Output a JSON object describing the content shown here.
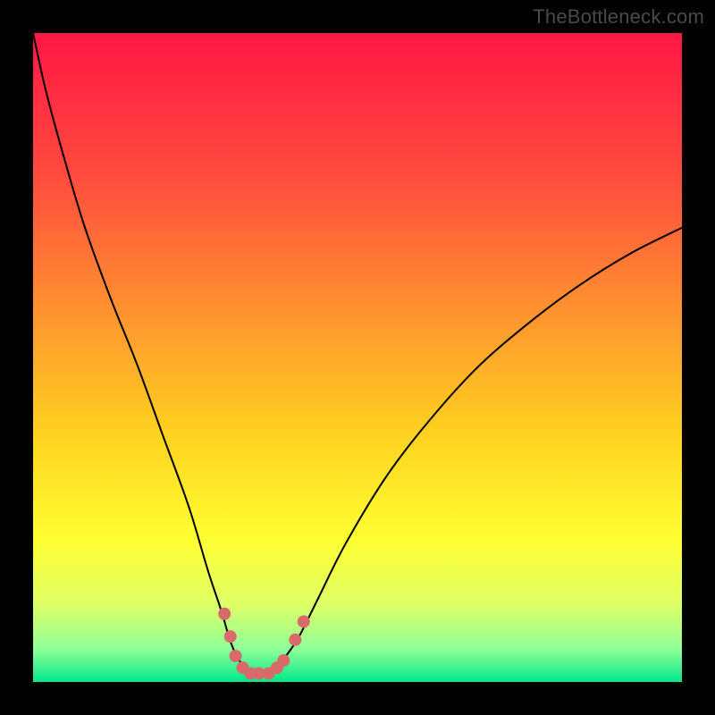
{
  "watermark": "TheBottleneck.com",
  "chart_data": {
    "type": "line",
    "title": "",
    "xlabel": "",
    "ylabel": "",
    "xlim": [
      0,
      100
    ],
    "ylim": [
      0,
      100
    ],
    "grid": false,
    "legend": false,
    "background_gradient": {
      "orientation": "vertical",
      "stops": [
        {
          "pct": 0,
          "color": "#ff1744"
        },
        {
          "pct": 22,
          "color": "#ff4b3e"
        },
        {
          "pct": 45,
          "color": "#ff9a2e"
        },
        {
          "pct": 62,
          "color": "#ffd21f"
        },
        {
          "pct": 78,
          "color": "#ffff33"
        },
        {
          "pct": 88,
          "color": "#dfff66"
        },
        {
          "pct": 95,
          "color": "#8fff99"
        },
        {
          "pct": 100,
          "color": "#00e88a"
        }
      ]
    },
    "series": [
      {
        "name": "bottleneck-curve",
        "x": [
          0,
          2,
          5,
          8,
          12,
          16,
          20,
          24,
          27,
          29,
          30.5,
          32,
          34,
          36,
          38,
          39,
          41,
          44,
          48,
          54,
          60,
          68,
          76,
          84,
          92,
          100
        ],
        "y": [
          100,
          91,
          80,
          70,
          59,
          49,
          38,
          27,
          17,
          11,
          6,
          3,
          1.3,
          1.3,
          2.2,
          4,
          7,
          13,
          21,
          31,
          39,
          48,
          55,
          61,
          66,
          70
        ]
      }
    ],
    "markers": {
      "name": "highlight-points",
      "color": "#d96a6a",
      "radius_px": 7,
      "points": [
        {
          "x": 29.5,
          "y": 10.5
        },
        {
          "x": 30.4,
          "y": 7.0
        },
        {
          "x": 31.2,
          "y": 4.0
        },
        {
          "x": 32.3,
          "y": 2.2
        },
        {
          "x": 33.5,
          "y": 1.3
        },
        {
          "x": 34.8,
          "y": 1.3
        },
        {
          "x": 36.3,
          "y": 1.3
        },
        {
          "x": 37.6,
          "y": 2.2
        },
        {
          "x": 38.6,
          "y": 3.3
        },
        {
          "x": 40.4,
          "y": 6.5
        },
        {
          "x": 41.7,
          "y": 9.3
        }
      ]
    }
  }
}
